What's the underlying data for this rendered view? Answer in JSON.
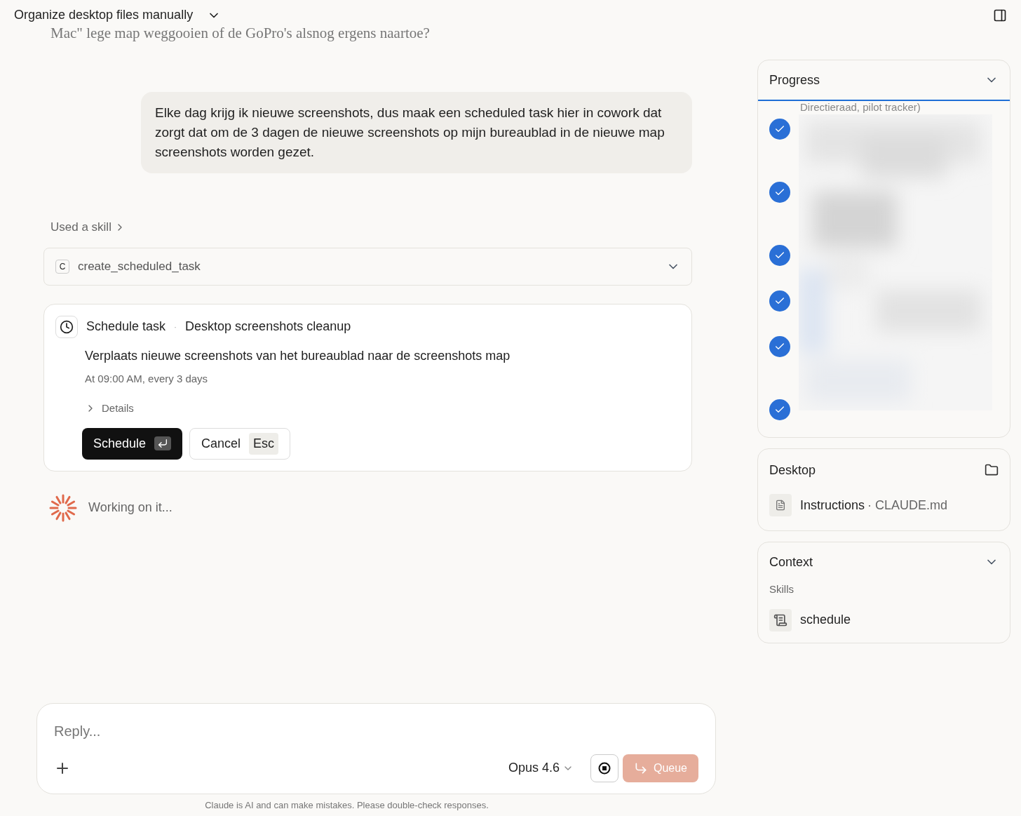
{
  "header": {
    "title": "Organize desktop files manually"
  },
  "scrolled_text": "Mac\" lege map weggooien of de GoPro's alsnog ergens naartoe?",
  "user_message": "Elke dag krijg ik nieuwe screenshots, dus maak een scheduled task hier in cowork dat zorgt dat om de 3 dagen de nieuwe screenshots op mijn bureaublad in de nieuwe map screenshots worden gezet.",
  "skill_link": "Used a skill",
  "tool_call": {
    "badge": "C",
    "name": "create_scheduled_task",
    "expanded": false
  },
  "schedule_card": {
    "title": "Schedule task",
    "separator": "·",
    "task_name": "Desktop screenshots cleanup",
    "description": "Verplaats nieuwe screenshots van het bureaublad naar de screenshots map",
    "timing": "At 09:00 AM, every 3 days",
    "details": {
      "label": "Details",
      "expanded": false
    },
    "buttons": [
      {
        "kind": "primary",
        "label": "Schedule"
      },
      {
        "kind": "secondary",
        "label": "Cancel",
        "shortcut": "Esc"
      }
    ]
  },
  "status": "Working on it...",
  "progress": {
    "title": "Progress",
    "expanded": true,
    "scrolled_text": "Directieraad, pilot tracker)",
    "steps": [
      {
        "checked": true
      },
      {
        "checked": true
      },
      {
        "checked": true
      },
      {
        "checked": true
      },
      {
        "checked": true
      },
      {
        "checked": true
      }
    ]
  },
  "desktop": {
    "title": "Desktop",
    "files": [
      {
        "name": "Instructions",
        "separator": "·",
        "detail": "CLAUDE.md"
      }
    ]
  },
  "context": {
    "title": "Context",
    "expanded": true,
    "section": "Skills",
    "skills": [
      "schedule"
    ]
  },
  "composer": {
    "placeholder": "Reply...",
    "model": "Opus 4.6",
    "queue": "Queue"
  },
  "disclaimer": "Claude is AI and can make mistakes. Please double-check responses."
}
